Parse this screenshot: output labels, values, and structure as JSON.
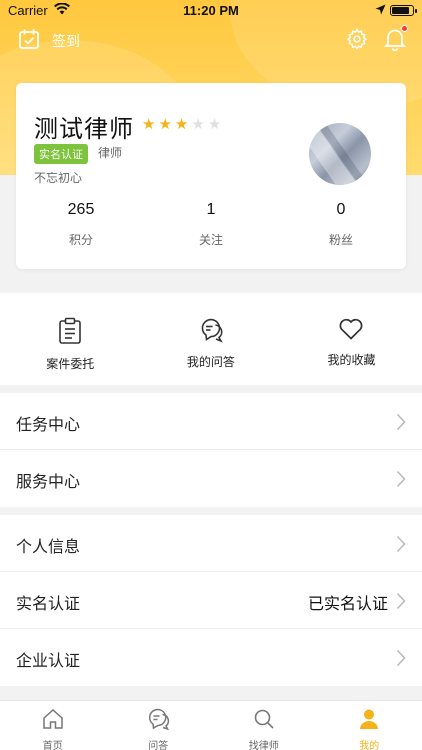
{
  "status_bar": {
    "carrier": "Carrier",
    "time": "11:20 PM"
  },
  "top_bar": {
    "checkin_label": "签到"
  },
  "profile": {
    "name": "测试律师",
    "rating": 3,
    "rating_max": 5,
    "verified_badge": "实名认证",
    "role": "律师",
    "motto": "不忘初心",
    "stats": [
      {
        "value": "265",
        "label": "积分"
      },
      {
        "value": "1",
        "label": "关注"
      },
      {
        "value": "0",
        "label": "粉丝"
      }
    ]
  },
  "quick_actions": [
    {
      "label": "案件委托",
      "icon": "clipboard-icon"
    },
    {
      "label": "我的问答",
      "icon": "chat-bubbles-icon"
    },
    {
      "label": "我的收藏",
      "icon": "heart-icon"
    }
  ],
  "menu_group_1": [
    {
      "label": "任务中心"
    },
    {
      "label": "服务中心"
    }
  ],
  "menu_group_2": [
    {
      "label": "个人信息",
      "value": ""
    },
    {
      "label": "实名认证",
      "value": "已实名认证"
    },
    {
      "label": "企业认证",
      "value": ""
    }
  ],
  "tab_bar": [
    {
      "label": "首页",
      "icon": "home-icon"
    },
    {
      "label": "问答",
      "icon": "chat-icon"
    },
    {
      "label": "找律师",
      "icon": "search-icon"
    },
    {
      "label": "我的",
      "icon": "person-icon",
      "active": true
    }
  ],
  "colors": {
    "accent": "#f5b21b",
    "header_gradient_top": "#ffc83d",
    "verified_green": "#7dc33b",
    "notification_dot": "#ff3b30"
  }
}
